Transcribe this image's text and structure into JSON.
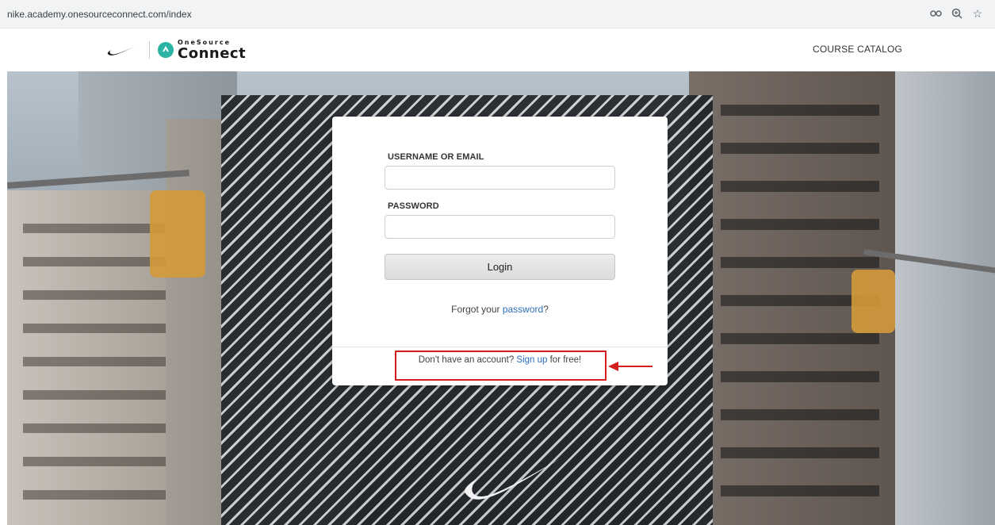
{
  "browser": {
    "url": "nike.academy.onesourceconnect.com/index",
    "icons": [
      "key-icon",
      "zoom-icon",
      "bookmark-star-icon"
    ]
  },
  "header": {
    "brand_top": "OneSource",
    "brand_bottom": "Connect",
    "nav_catalog": "COURSE CATALOG"
  },
  "login": {
    "username_label": "USERNAME OR EMAIL",
    "username_value": "",
    "password_label": "PASSWORD",
    "password_value": "",
    "login_button": "Login",
    "forgot_prefix": "Forgot your ",
    "forgot_link": "password",
    "forgot_suffix": "?",
    "signup_prefix": "Don't have an account? ",
    "signup_link": "Sign up",
    "signup_suffix": " for free!"
  },
  "colors": {
    "link": "#2a6ebb",
    "highlight": "#d41e1e",
    "brand_badge": "#2bb3a3"
  }
}
